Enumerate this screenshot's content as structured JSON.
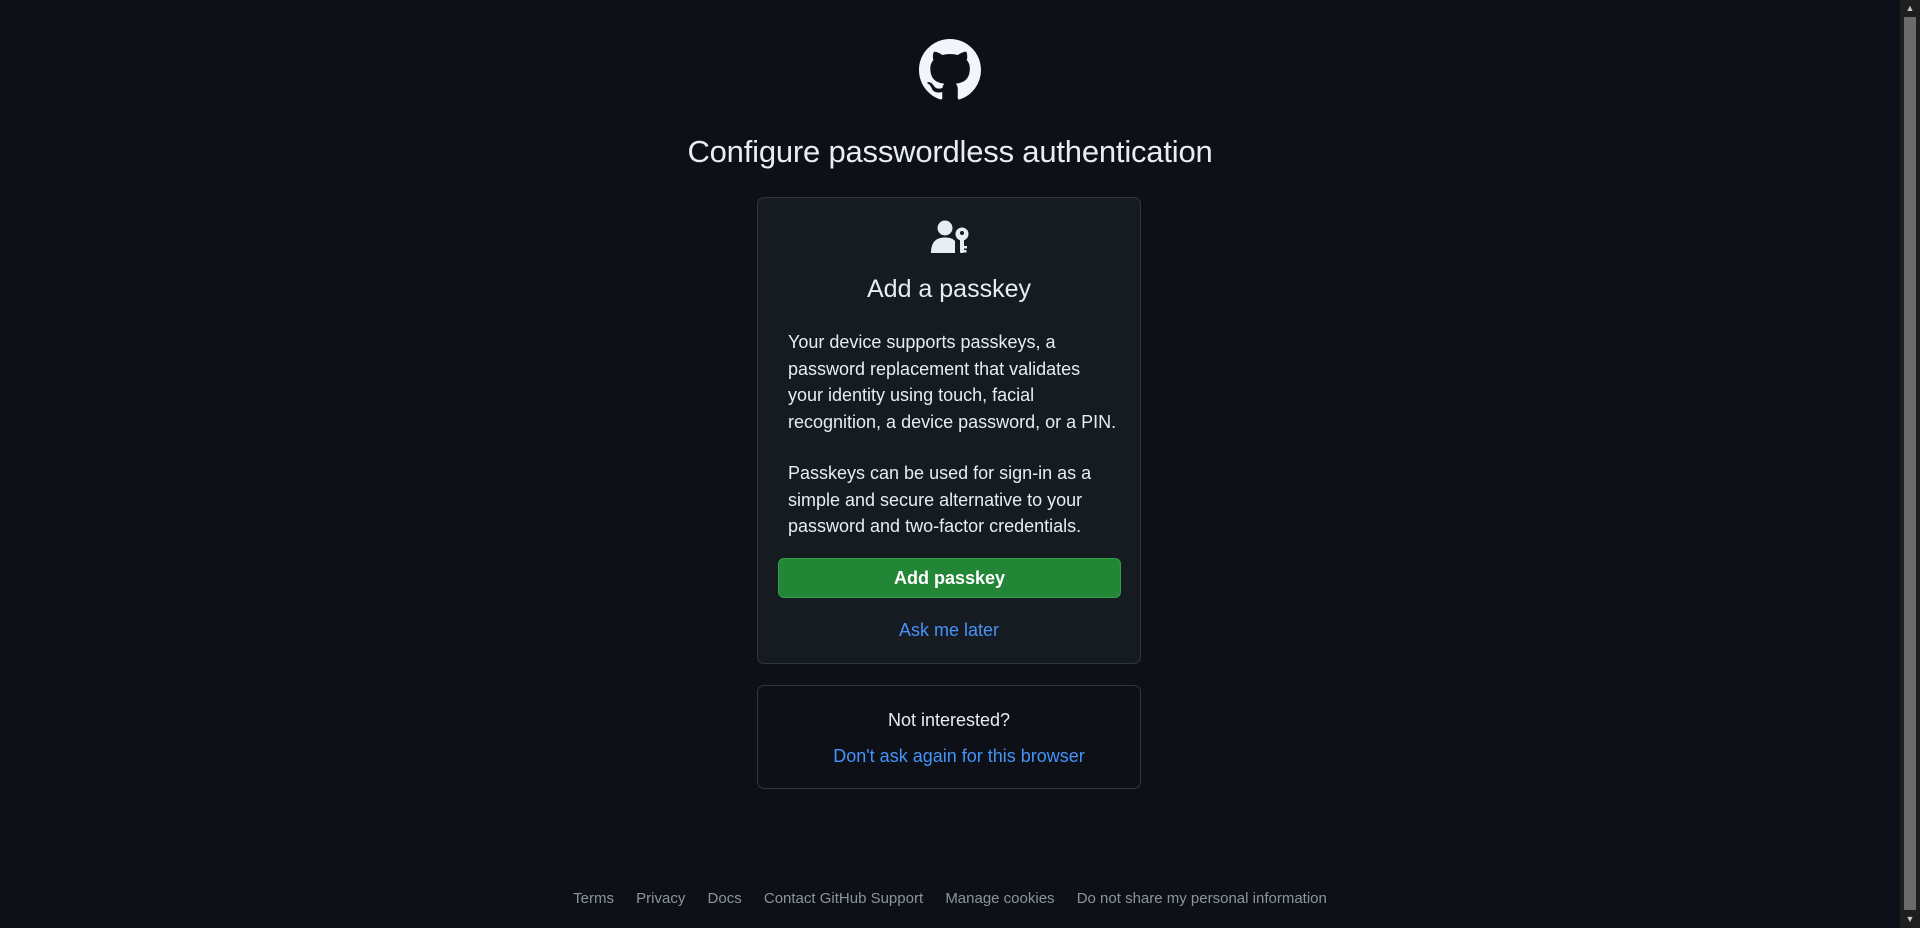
{
  "page": {
    "title": "Configure passwordless authentication",
    "logo_icon": "github-mark-icon"
  },
  "card": {
    "icon": "passkey-person-key-icon",
    "title": "Add a passkey",
    "paragraph_1": "Your device supports passkeys, a password replacement that validates your identity using touch, facial recognition, a device password, or a PIN.",
    "paragraph_2": "Passkeys can be used for sign-in as a simple and secure alternative to your password and two-factor credentials.",
    "primary_button": "Add passkey",
    "later_link": "Ask me later"
  },
  "secondary_card": {
    "heading": "Not interested?",
    "link": "Don't ask again for this browser"
  },
  "footer": {
    "links": [
      "Terms",
      "Privacy",
      "Docs",
      "Contact GitHub Support",
      "Manage cookies",
      "Do not share my personal information"
    ]
  },
  "colors": {
    "background": "#0d1117",
    "card_background": "#161b22",
    "border": "#30363d",
    "primary_button": "#238636",
    "link": "#4493f8",
    "muted_text": "#8b949e"
  }
}
